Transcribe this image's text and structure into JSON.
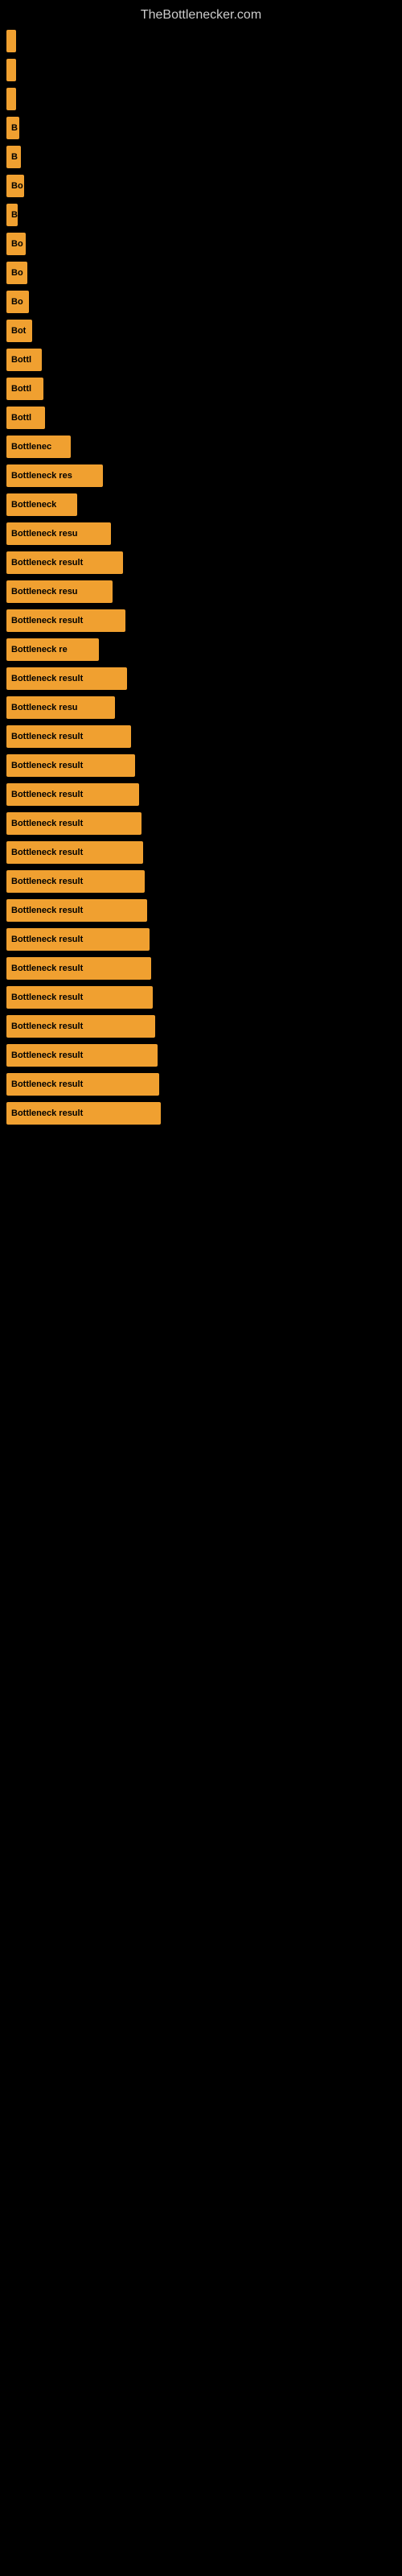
{
  "site_title": "TheBottlenecker.com",
  "bars": [
    {
      "label": "",
      "width": 8
    },
    {
      "label": "",
      "width": 10
    },
    {
      "label": "",
      "width": 12
    },
    {
      "label": "B",
      "width": 16
    },
    {
      "label": "B",
      "width": 18
    },
    {
      "label": "Bo",
      "width": 22
    },
    {
      "label": "B",
      "width": 14
    },
    {
      "label": "Bo",
      "width": 24
    },
    {
      "label": "Bo",
      "width": 26
    },
    {
      "label": "Bo",
      "width": 28
    },
    {
      "label": "Bot",
      "width": 32
    },
    {
      "label": "Bottl",
      "width": 44
    },
    {
      "label": "Bottl",
      "width": 46
    },
    {
      "label": "Bottl",
      "width": 48
    },
    {
      "label": "Bottlenec",
      "width": 80
    },
    {
      "label": "Bottleneck res",
      "width": 120
    },
    {
      "label": "Bottleneck",
      "width": 88
    },
    {
      "label": "Bottleneck resu",
      "width": 130
    },
    {
      "label": "Bottleneck result",
      "width": 145
    },
    {
      "label": "Bottleneck resu",
      "width": 132
    },
    {
      "label": "Bottleneck result",
      "width": 148
    },
    {
      "label": "Bottleneck re",
      "width": 115
    },
    {
      "label": "Bottleneck result",
      "width": 150
    },
    {
      "label": "Bottleneck resu",
      "width": 135
    },
    {
      "label": "Bottleneck result",
      "width": 155
    },
    {
      "label": "Bottleneck result",
      "width": 160
    },
    {
      "label": "Bottleneck result",
      "width": 165
    },
    {
      "label": "Bottleneck result",
      "width": 168
    },
    {
      "label": "Bottleneck result",
      "width": 170
    },
    {
      "label": "Bottleneck result",
      "width": 172
    },
    {
      "label": "Bottleneck result",
      "width": 175
    },
    {
      "label": "Bottleneck result",
      "width": 178
    },
    {
      "label": "Bottleneck result",
      "width": 180
    },
    {
      "label": "Bottleneck result",
      "width": 182
    },
    {
      "label": "Bottleneck result",
      "width": 185
    },
    {
      "label": "Bottleneck result",
      "width": 188
    },
    {
      "label": "Bottleneck result",
      "width": 190
    },
    {
      "label": "Bottleneck result",
      "width": 192
    }
  ],
  "accent_color": "#f0a030"
}
